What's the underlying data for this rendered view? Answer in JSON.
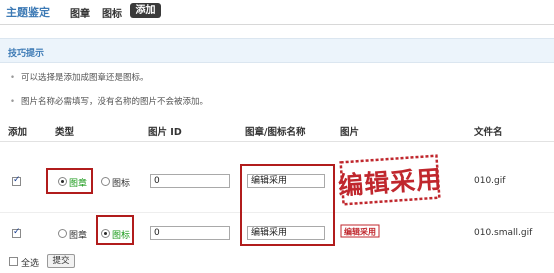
{
  "header": {
    "title": "主题鉴定",
    "tabs": [
      {
        "label": "图章",
        "active": false
      },
      {
        "label": "图标",
        "active": false
      },
      {
        "label": "添加",
        "active": true
      }
    ]
  },
  "tips": {
    "title": "技巧提示",
    "items": [
      "可以选择是添加成图章还是图标。",
      "图片名称必需填写，没有名称的图片不会被添加。"
    ]
  },
  "table": {
    "headers": {
      "add": "添加",
      "type": "类型",
      "image_id": "图片 ID",
      "name": "图章/图标名称",
      "image": "图片",
      "filename": "文件名"
    },
    "rows": [
      {
        "checked": true,
        "type_options": [
          "图章",
          "图标"
        ],
        "selected_type": "图章",
        "image_id": "0",
        "name": "编辑采用",
        "image_text": "编辑采用",
        "filename": "010.gif"
      },
      {
        "checked": true,
        "type_options": [
          "图章",
          "图标"
        ],
        "selected_type": "图标",
        "image_id": "0",
        "name": "编辑采用",
        "image_text": "编辑采用",
        "filename": "010.small.gif"
      }
    ]
  },
  "footer": {
    "select_all_label": "全选",
    "submit_label": "提交"
  },
  "colors": {
    "accent": "#3d7ab5",
    "stamp_red": "#c0272d",
    "highlight_box": "#b11c1c",
    "selected_label": "#1a9a1a"
  }
}
